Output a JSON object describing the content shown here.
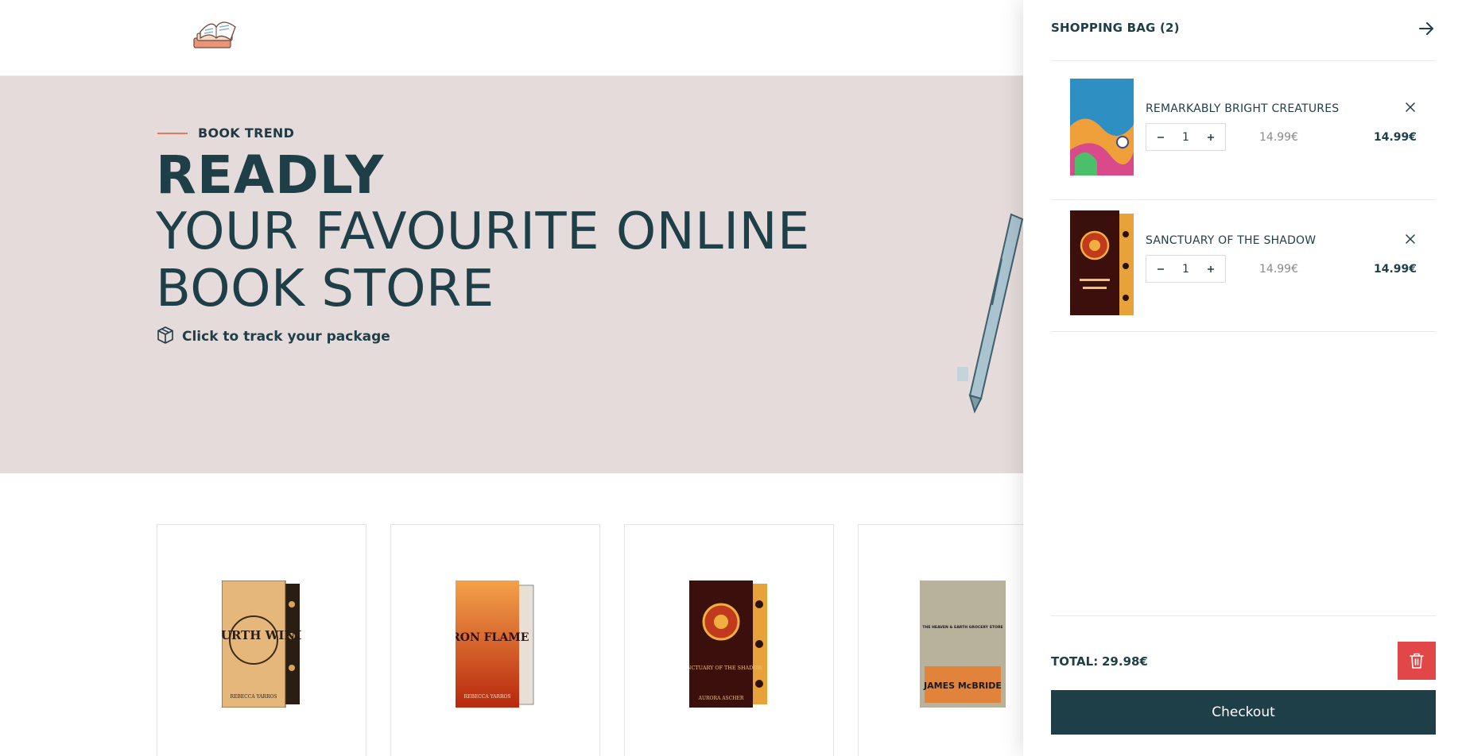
{
  "hero": {
    "eyebrow": "BOOK TREND",
    "title": "READLY",
    "subtitle": "YOUR FAVOURITE ONLINE BOOK STORE",
    "track_link": "Click to track your package"
  },
  "products": [
    {
      "cover_title": "FOURTH WING",
      "author": "REBECCA YARROS"
    },
    {
      "cover_title": "IRON FLAME",
      "author": "REBECCA YARROS"
    },
    {
      "cover_title": "SANCTUARY OF THE SHADOW",
      "author": "AURORA ASCHER"
    },
    {
      "cover_title": "THE HEAVEN & EARTH GROCERY STORE",
      "author": "JAMES McBRIDE"
    }
  ],
  "cart": {
    "title": "SHOPPING BAG (2)",
    "items": [
      {
        "name": "REMARKABLY BRIGHT CREATURES",
        "quantity": "1",
        "unit_price": "14.99€",
        "line_total": "14.99€"
      },
      {
        "name": "SANCTUARY OF THE SHADOW",
        "quantity": "1",
        "unit_price": "14.99€",
        "line_total": "14.99€"
      }
    ],
    "total_label": "TOTAL:",
    "total_value": "29.98€",
    "checkout_label": "Checkout"
  },
  "colors": {
    "brand_dark": "#1e3e48",
    "hero_bg": "#e6dbdb",
    "accent": "#e2795d",
    "danger": "#e14747"
  }
}
